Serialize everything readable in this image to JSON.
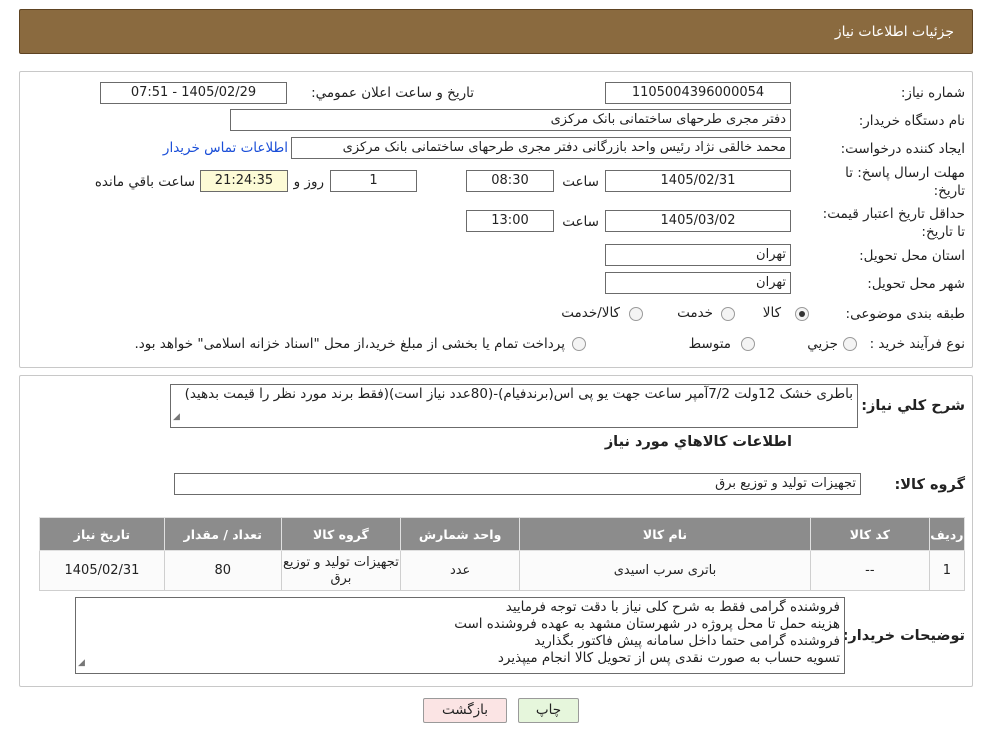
{
  "header": {
    "title": "جزئیات اطلاعات نیاز"
  },
  "watermark": {
    "text": "AriaTender.neT"
  },
  "form": {
    "need_number_label": "شماره نیاز:",
    "need_number": "1105004396000054",
    "announce_label": "تاریخ و ساعت اعلان عمومي:",
    "announce_value": "1405/02/29 - 07:51",
    "buyer_org_label": "نام دستگاه خریدار:",
    "buyer_org": "دفتر مجری طرحهای ساختمانی بانک مرکزی",
    "creator_label": "ایجاد کننده درخواست:",
    "creator": "محمد خالقی نژاد رئیس واحد بازرگانی دفتر مجری طرحهای ساختمانی بانک مرکزی",
    "contact_link": "اطلاعات تماس خریدار",
    "deadline_label": "مهلت ارسال پاسخ: تا تاریخ:",
    "deadline_date": "1405/02/31",
    "time_label": "ساعت",
    "deadline_time": "08:30",
    "days_value": "1",
    "days_label": "روز و",
    "remaining_time": "21:24:35",
    "remaining_label": "ساعت باقي مانده",
    "validity_label": "حداقل تاریخ اعتبار قیمت: تا تاریخ:",
    "validity_date": "1405/03/02",
    "validity_time": "13:00",
    "province_label": "استان محل تحویل:",
    "province": "تهران",
    "city_label": "شهر محل تحویل:",
    "city": "تهران",
    "category_label": "طبقه بندی موضوعی:",
    "category_options": [
      "کالا",
      "خدمت",
      "کالا/خدمت"
    ],
    "category_selected": "کالا",
    "process_label": "نوع فرآیند خرید :",
    "process_options": [
      "جزیي",
      "متوسط"
    ],
    "process_note": "پرداخت تمام یا بخشی از مبلغ خرید،از محل \"اسناد خزانه اسلامی\" خواهد بود."
  },
  "description": {
    "label": "شرح کلي نیاز:",
    "text": "باطری خشک 12ولت 7/2آمپر ساعت جهت یو پی اس(برندفیام)-(80عدد نیاز است)(فقط برند مورد نظر را قیمت بدهید)"
  },
  "goods": {
    "section_title": "اطلاعات کالاهاي مورد نیاز",
    "group_label": "گروه کالا:",
    "group_value": "تجهیزات تولید و توزیع برق",
    "table": {
      "headers": [
        "ردیف",
        "کد کالا",
        "نام کالا",
        "واحد شمارش",
        "گروه کالا",
        "تعداد / مقدار",
        "تاریخ نیاز"
      ],
      "rows": [
        [
          "1",
          "--",
          "باتری سرب اسیدی",
          "عدد",
          "تجهیزات تولید و توزیع برق",
          "80",
          "1405/02/31"
        ]
      ]
    }
  },
  "buyer_notes": {
    "label": "توضیحات خریدار:",
    "lines": [
      "فروشنده گرامی فقط به شرح کلی نیاز  با دقت توجه فرمایید",
      "هزینه حمل تا محل پروژه در شهرستان مشهد به عهده فروشنده است",
      "فروشنده گرامی حتما داخل سامانه پیش فاکتور بگذارید",
      "تسویه حساب به صورت نقدی پس از تحویل کالا  انجام میپذیرد"
    ]
  },
  "buttons": {
    "print": "چاپ",
    "back": "بازگشت"
  }
}
